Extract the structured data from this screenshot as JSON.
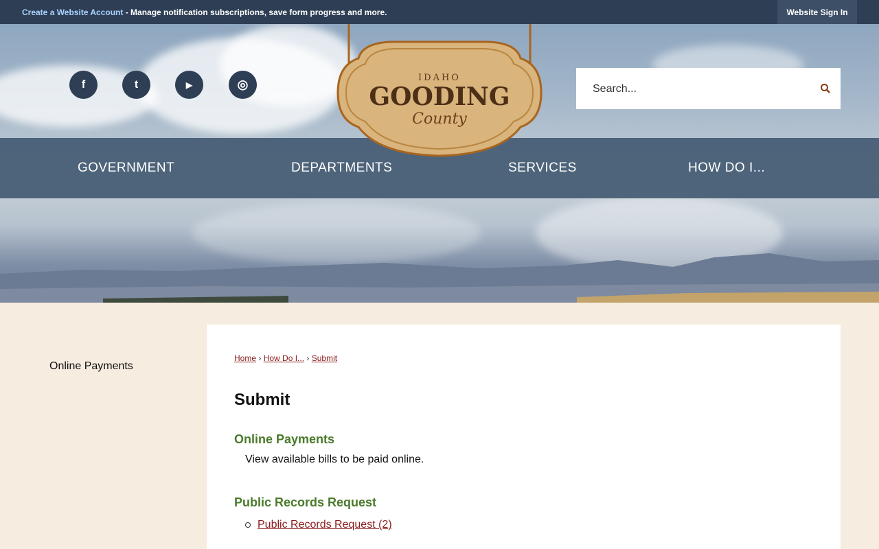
{
  "topbar": {
    "create_account_link": "Create a Website Account",
    "message": " - Manage notification subscriptions, save form progress and more.",
    "signin_label": "Website Sign In"
  },
  "header": {
    "social": [
      {
        "name": "facebook-icon",
        "glyph": "f"
      },
      {
        "name": "twitter-icon",
        "glyph": "t"
      },
      {
        "name": "youtube-icon",
        "glyph": "▶"
      },
      {
        "name": "instagram-icon",
        "glyph": "◎"
      }
    ],
    "logo": {
      "state": "IDAHO",
      "name": "GOODING",
      "sub": "County"
    },
    "search": {
      "placeholder": "Search..."
    }
  },
  "nav": {
    "items": [
      {
        "label": "GOVERNMENT"
      },
      {
        "label": "DEPARTMENTS"
      },
      {
        "label": "SERVICES"
      },
      {
        "label": "HOW DO I..."
      }
    ]
  },
  "sidebar": {
    "items": [
      {
        "label": "Online Payments"
      }
    ]
  },
  "main": {
    "breadcrumb": [
      {
        "label": "Home"
      },
      {
        "label": "How Do I..."
      },
      {
        "label": "Submit"
      }
    ],
    "title": "Submit",
    "sections": [
      {
        "title": "Online Payments",
        "description": "View available bills to be paid online."
      },
      {
        "title": "Public Records Request",
        "links": [
          {
            "label": "Public Records Request (2)"
          }
        ]
      }
    ]
  },
  "colors": {
    "topbar": "#2e3f55",
    "nav": "#3e556e",
    "section_title": "#4a7a2a",
    "link": "#8a1b1b",
    "page_bg": "#f6ece0"
  }
}
